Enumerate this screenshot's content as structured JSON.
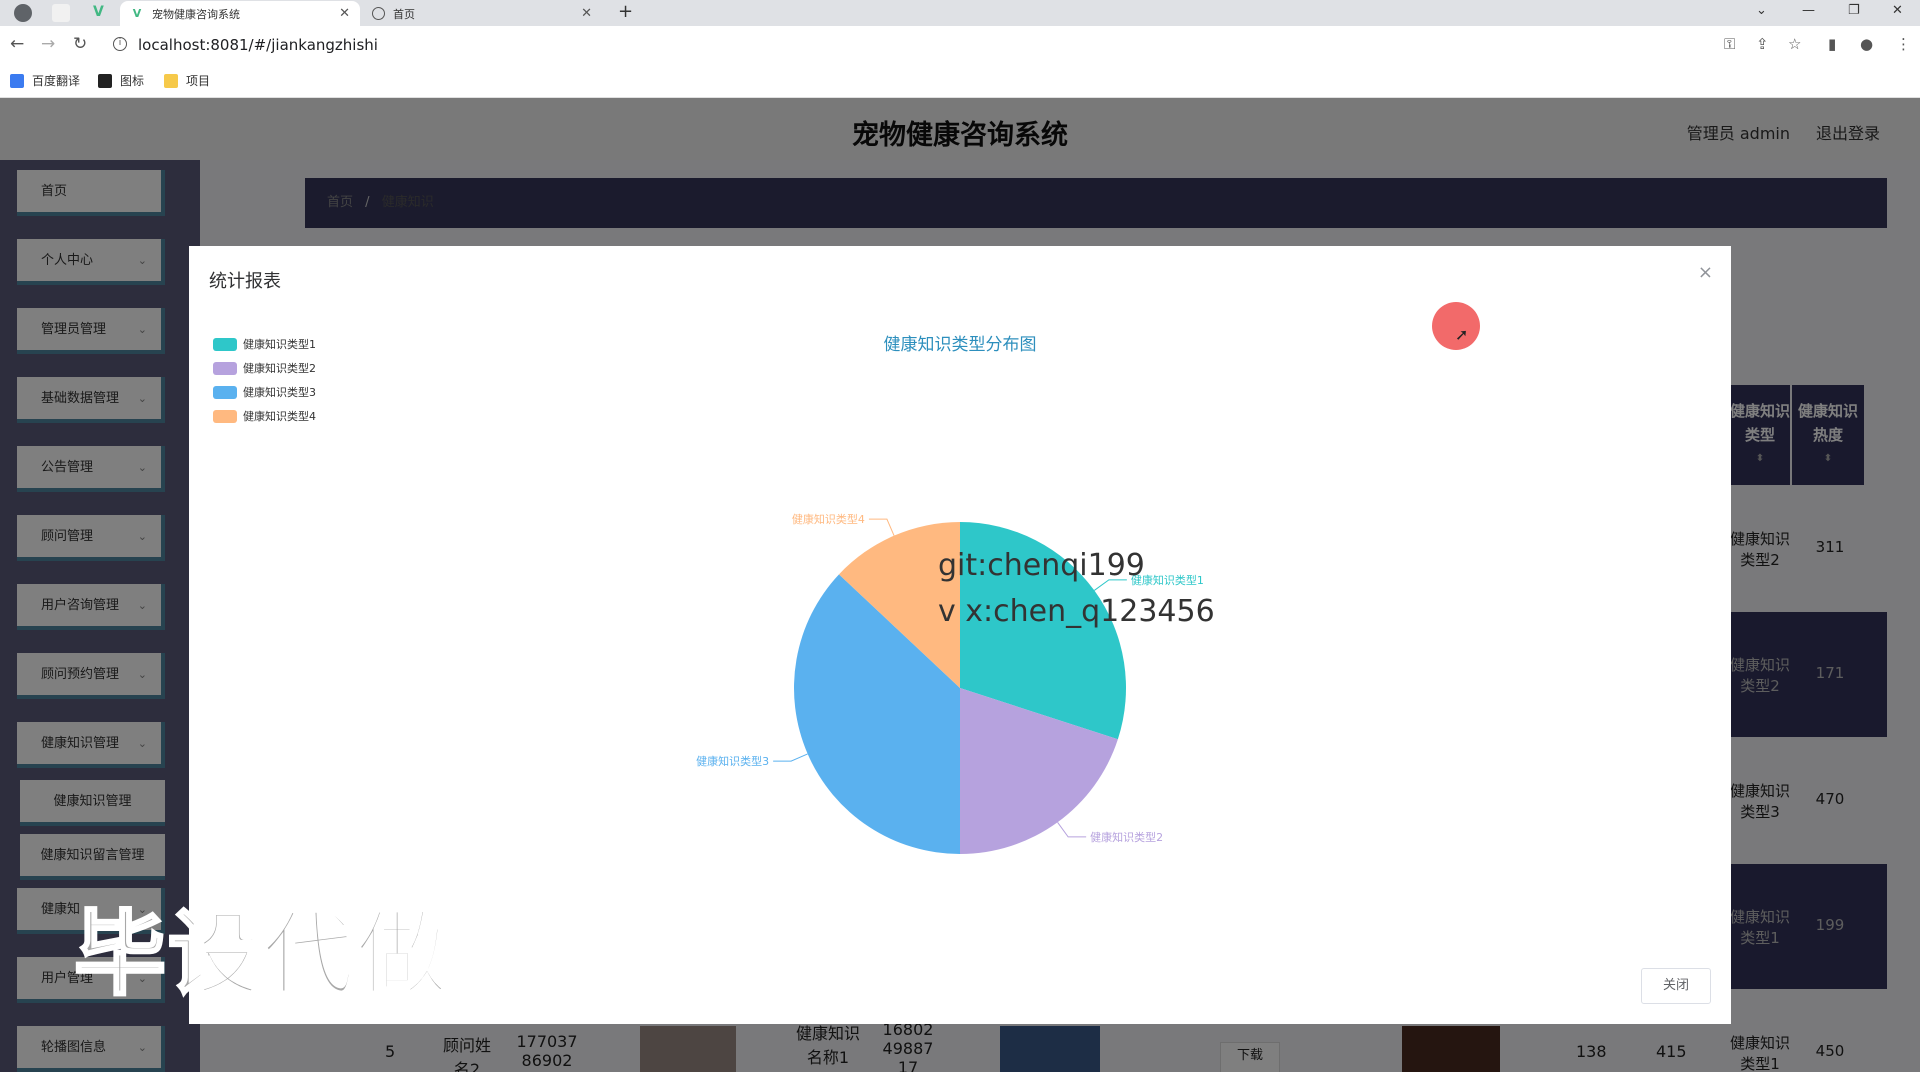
{
  "browser": {
    "tabs": [
      {
        "label": "宠物健康咨询系统",
        "active": true
      },
      {
        "label": "首页",
        "active": false
      }
    ],
    "new_tab": "+",
    "url": "localhost:8081/#/jiankangzhishi",
    "bookmarks": [
      "百度翻译",
      "图标",
      "项目"
    ],
    "window_controls": [
      "⌄",
      "—",
      "❐",
      "✕"
    ]
  },
  "app": {
    "title": "宠物健康咨询系统",
    "user_label": "管理员 admin",
    "logout_label": "退出登录",
    "sidebar": [
      {
        "label": "首页",
        "chevron": false
      },
      {
        "label": "个人中心",
        "chevron": true
      },
      {
        "label": "管理员管理",
        "chevron": true
      },
      {
        "label": "基础数据管理",
        "chevron": true
      },
      {
        "label": "公告管理",
        "chevron": true
      },
      {
        "label": "顾问管理",
        "chevron": true
      },
      {
        "label": "用户咨询管理",
        "chevron": true
      },
      {
        "label": "顾问预约管理",
        "chevron": true
      },
      {
        "label": "健康知识管理",
        "chevron": true
      },
      {
        "label": "健康知识管理",
        "chevron": false,
        "sub": true
      },
      {
        "label": "健康知识留言管理",
        "chevron": false,
        "sub": true
      },
      {
        "label": "健康知",
        "chevron": true
      },
      {
        "label": "用户管理",
        "chevron": true
      },
      {
        "label": "轮播图信息",
        "chevron": true
      }
    ],
    "breadcrumb": {
      "home": "首页",
      "separator": "/",
      "current": "健康知识"
    },
    "table": {
      "headers": [
        "健康知识类型",
        "健康知识热度"
      ],
      "rows": [
        {
          "type": "健康知识类型2",
          "heat": "311"
        },
        {
          "type": "健康知识类型2",
          "heat": "171"
        },
        {
          "type": "健康知识类型3",
          "heat": "470"
        },
        {
          "type": "健康知识类型1",
          "heat": "199"
        },
        {
          "type": "健康知识类型1",
          "heat": "450"
        }
      ],
      "bottom_row": {
        "index": "5",
        "consultant": "顾问姓名2",
        "phone": "17703786902",
        "knowledge_name": "健康知识名称1",
        "code": "168024988717",
        "download": "下载",
        "n1": "138",
        "n2": "415"
      }
    }
  },
  "modal": {
    "title": "统计报表",
    "close_icon": "×",
    "footer_button": "关闭"
  },
  "chart_data": {
    "type": "pie",
    "title": "健康知识类型分布图",
    "legend_position": "top-left",
    "series": [
      {
        "name": "健康知识类型1",
        "value": 30,
        "color": "#2ec7c9"
      },
      {
        "name": "健康知识类型2",
        "value": 20,
        "color": "#b6a2de"
      },
      {
        "name": "健康知识类型3",
        "value": 37,
        "color": "#5ab1ef"
      },
      {
        "name": "健康知识类型4",
        "value": 13,
        "color": "#ffb980"
      }
    ]
  },
  "overlay_text": {
    "line1": "git:chenqi199",
    "line2": "v x:chen_q123456",
    "watermark": "毕设代做"
  }
}
